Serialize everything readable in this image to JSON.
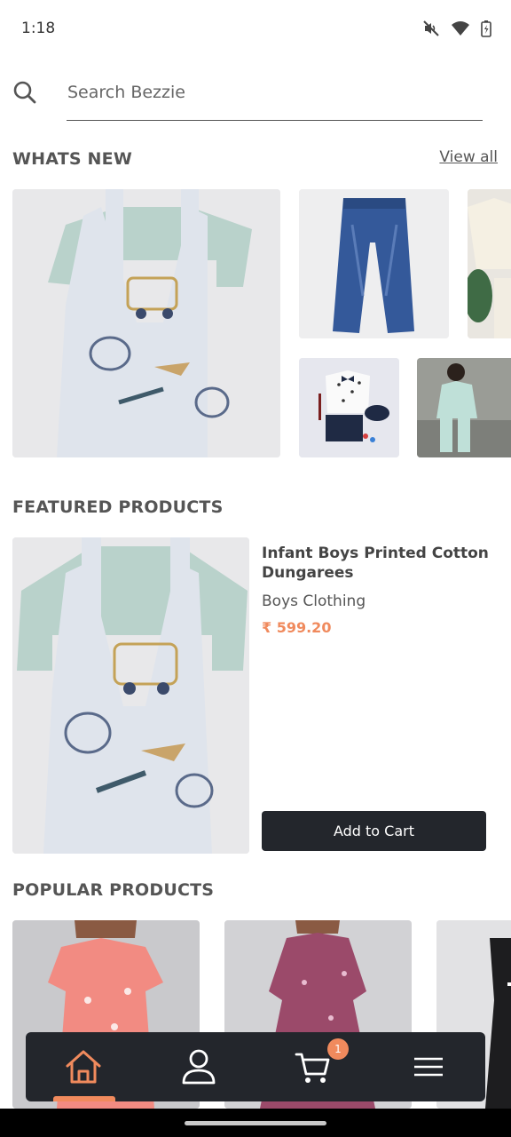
{
  "status_bar": {
    "time": "1:18",
    "icons": [
      "mute-icon",
      "wifi-icon",
      "battery-icon"
    ]
  },
  "search": {
    "placeholder": "Search Bezzie"
  },
  "whats_new": {
    "title": "WHATS NEW",
    "view_all": "View all",
    "images": [
      "dungarees-image",
      "jeans-image",
      "cream-outfit-image",
      "shirt-set-image",
      "kid-tracksuit-image"
    ]
  },
  "featured": {
    "title": "FEATURED PRODUCTS",
    "product": {
      "name": "Infant Boys Printed Cotton Dungarees",
      "category": "Boys Clothing",
      "price": "₹ 599.20",
      "button": "Add to Cart"
    }
  },
  "popular": {
    "title": "POPULAR PRODUCTS",
    "images": [
      "pink-dress-image",
      "maroon-dress-image",
      "black-white-dress-image"
    ]
  },
  "bottom_nav": {
    "items": [
      "home-icon",
      "profile-icon",
      "cart-icon",
      "menu-icon"
    ],
    "active": "home",
    "cart_badge": "1"
  },
  "colors": {
    "accent": "#f08a5d",
    "dark": "#23262c",
    "text": "#555555"
  }
}
